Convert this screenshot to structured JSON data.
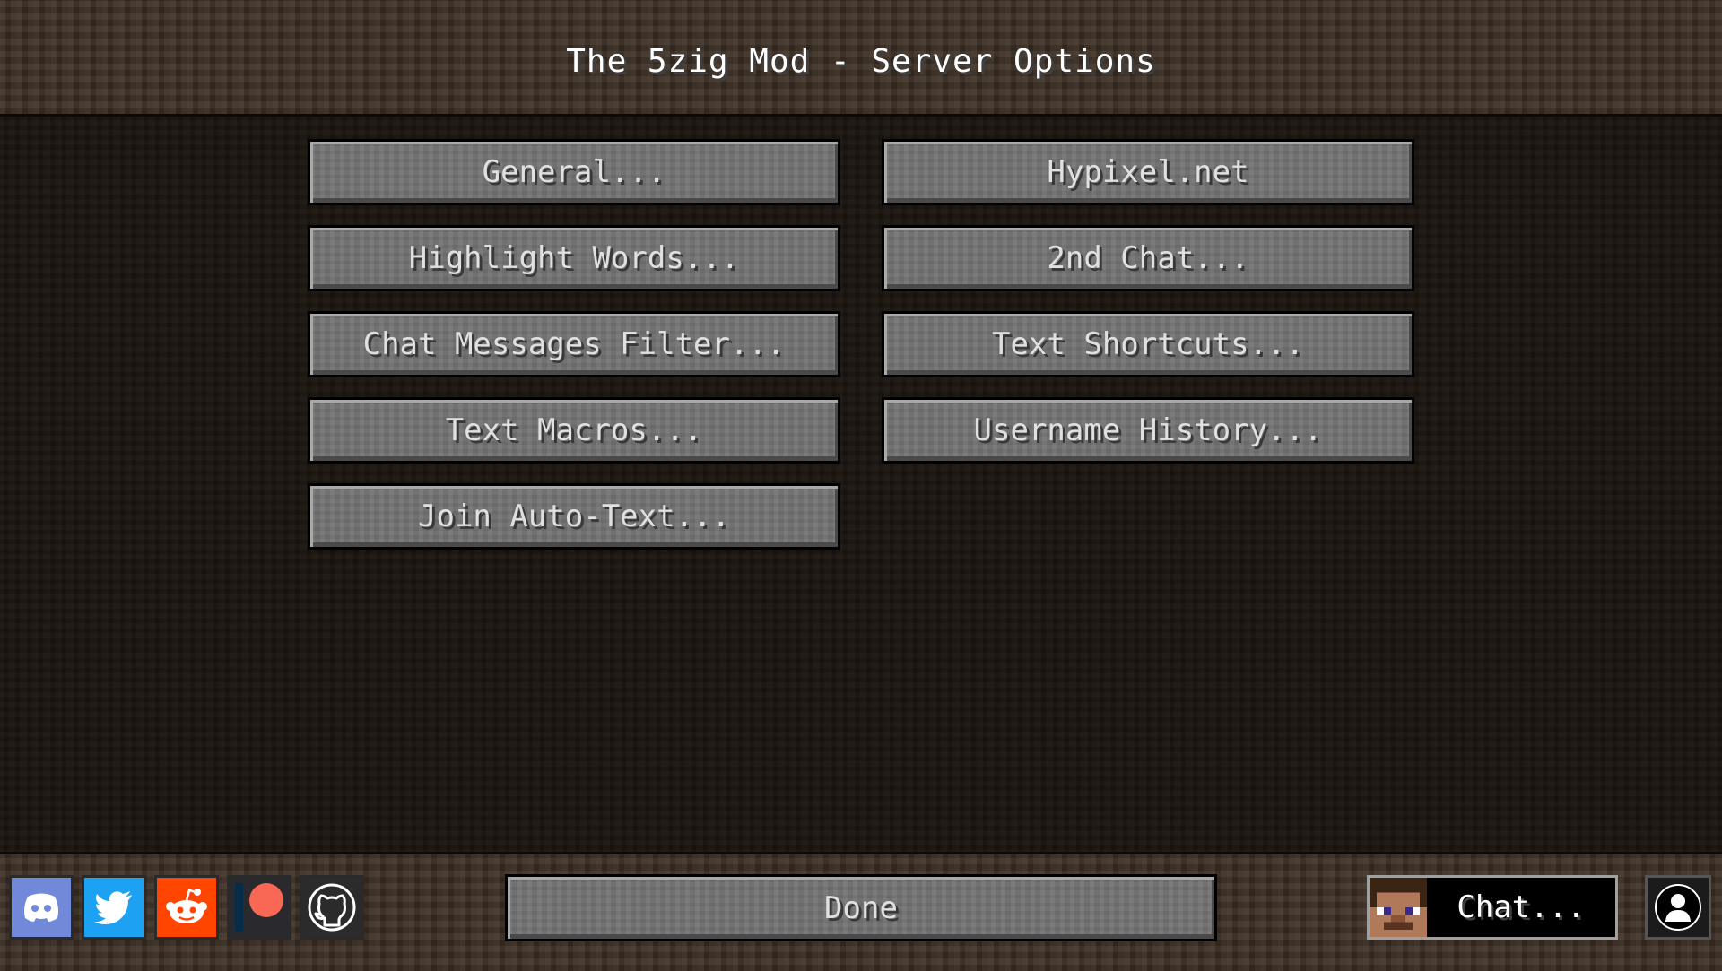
{
  "title": "The 5zig Mod - Server Options",
  "buttons": {
    "general": "General...",
    "hypixel": "Hypixel.net",
    "highlight_words": "Highlight Words...",
    "second_chat": "2nd Chat...",
    "chat_filter": "Chat Messages Filter...",
    "text_shortcuts": "Text Shortcuts...",
    "text_macros": "Text Macros...",
    "username_history": "Username History...",
    "join_auto_text": "Join Auto-Text..."
  },
  "footer": {
    "done_label": "Done",
    "chat_label": "Chat...",
    "social_icons": [
      "discord-icon",
      "twitter-icon",
      "reddit-icon",
      "patreon-icon",
      "github-icon"
    ]
  },
  "colors": {
    "discord": "#7289da",
    "twitter": "#1da1f2",
    "reddit": "#ff4500",
    "patreon": "#f96854",
    "github": "#24292e"
  }
}
